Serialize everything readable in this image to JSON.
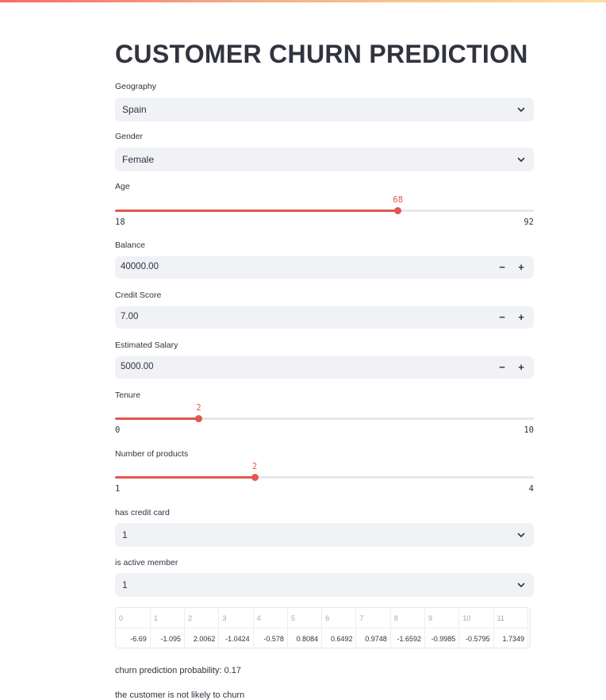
{
  "title": "CUSTOMER CHURN PREDICTION",
  "geography": {
    "label": "Geography",
    "value": "Spain"
  },
  "gender": {
    "label": "Gender",
    "value": "Female"
  },
  "age": {
    "label": "Age",
    "min": 18,
    "max": 92,
    "value": 68
  },
  "balance": {
    "label": "Balance",
    "value": "40000.00",
    "minus": "−",
    "plus": "+"
  },
  "credit_score": {
    "label": "Credit Score",
    "value": "7.00",
    "minus": "−",
    "plus": "+"
  },
  "estimated_salary": {
    "label": "Estimated Salary",
    "value": "5000.00",
    "minus": "−",
    "plus": "+"
  },
  "tenure": {
    "label": "Tenure",
    "min": 0,
    "max": 10,
    "value": 2
  },
  "num_products": {
    "label": "Number of products",
    "min": 1,
    "max": 4,
    "value": 2
  },
  "has_credit_card": {
    "label": "has credit card",
    "value": "1"
  },
  "is_active_member": {
    "label": "is active member",
    "value": "1"
  },
  "dataframe": {
    "columns": [
      "0",
      "1",
      "2",
      "3",
      "4",
      "5",
      "6",
      "7",
      "8",
      "9",
      "10",
      "11"
    ],
    "row": [
      "-6.69",
      "-1.095",
      "2.0062",
      "-1.0424",
      "-0.578",
      "0.8084",
      "0.6492",
      "0.9748",
      "-1.6592",
      "-0.9985",
      "-0.5795",
      "1.7349"
    ]
  },
  "probability_text": "churn prediction probability: 0.17",
  "result_text": "the customer is not likely to churn",
  "colors": {
    "accent": "#e0584f",
    "input_bg": "#f0f2f6",
    "text": "#31333f"
  }
}
